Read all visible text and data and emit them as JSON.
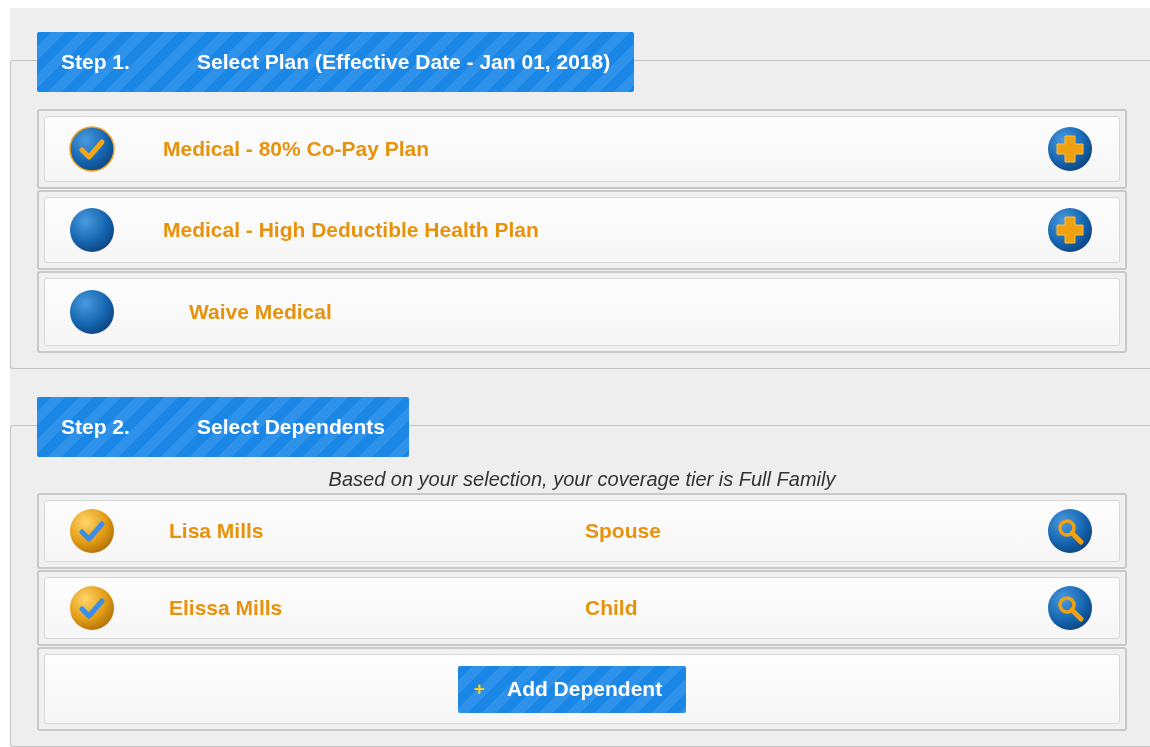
{
  "step1": {
    "step": "Step 1.",
    "title": "Select Plan (Effective Date - Jan 01, 2018)",
    "plans": [
      {
        "kind": "plan",
        "label": "Medical - 80% Co-Pay Plan",
        "selected": true
      },
      {
        "kind": "plan",
        "label": "Medical - High Deductible Health Plan",
        "selected": false
      },
      {
        "kind": "waive",
        "label": "Waive Medical",
        "selected": false
      }
    ]
  },
  "step2": {
    "step": "Step 2.",
    "title": "Select Dependents",
    "note": "Based on your selection, your coverage tier is Full Family",
    "dependents": [
      {
        "name": "Lisa Mills",
        "relationship": "Spouse",
        "checked": true
      },
      {
        "name": "Elissa Mills",
        "relationship": "Child",
        "checked": true
      }
    ],
    "add_button": {
      "icon": "+",
      "label": "Add Dependent"
    }
  }
}
